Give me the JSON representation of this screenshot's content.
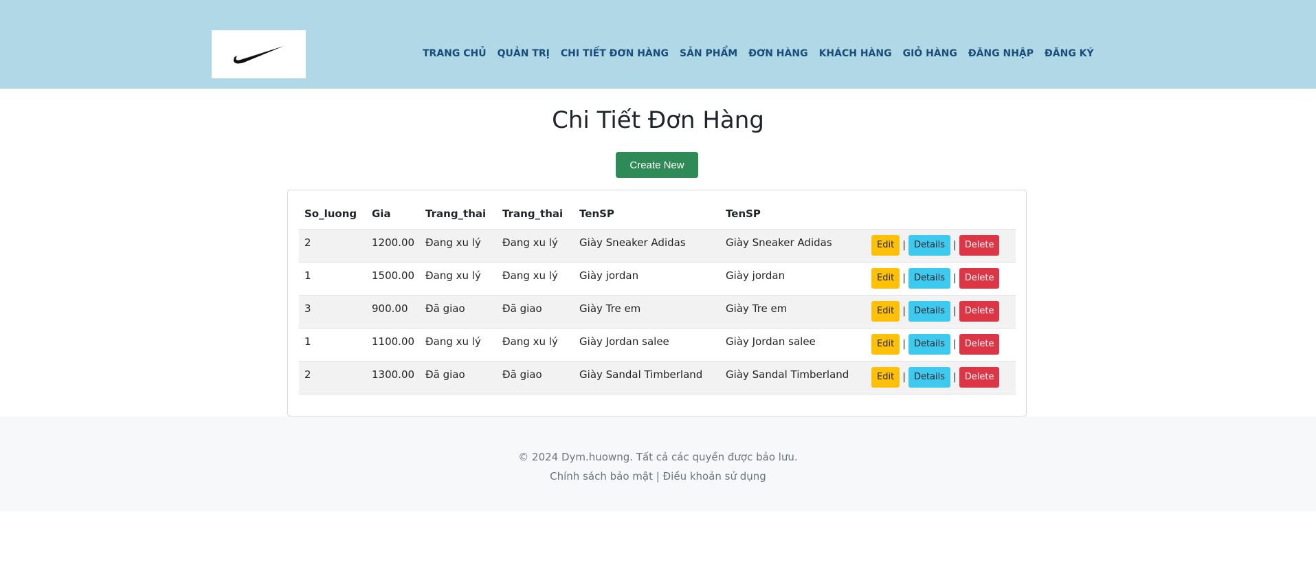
{
  "header": {
    "logo_icon": "nike-swoosh-icon",
    "nav": [
      "TRANG CHỦ",
      "QUẢN TRỊ",
      "CHI TIẾT ĐƠN HÀNG",
      "SẢN PHẨM",
      "ĐƠN HÀNG",
      "KHÁCH HÀNG",
      "GIỎ HÀNG",
      "ĐĂNG NHẬP",
      "ĐĂNG KÝ"
    ]
  },
  "main": {
    "title": "Chi Tiết Đơn Hàng",
    "create_label": "Create New"
  },
  "table": {
    "headers": [
      "So_luong",
      "Gia",
      "Trang_thai",
      "Trang_thai",
      "TenSP",
      "TenSP"
    ],
    "rows": [
      [
        "2",
        "1200.00",
        "Đang xu lý",
        "Đang xu lý",
        "Giày Sneaker Adidas",
        "Giày Sneaker Adidas"
      ],
      [
        "1",
        "1500.00",
        "Đang xu lý",
        "Đang xu lý",
        "Giày jordan",
        "Giày jordan"
      ],
      [
        "3",
        "900.00",
        "Đã giao",
        "Đã giao",
        "Giày Tre em",
        "Giày Tre em"
      ],
      [
        "1",
        "1100.00",
        "Đang xu lý",
        "Đang xu lý",
        "Giày Jordan salee",
        "Giày Jordan salee"
      ],
      [
        "2",
        "1300.00",
        "Đã giao",
        "Đã giao",
        "Giày Sandal Timberland",
        "Giày Sandal Timberland"
      ]
    ],
    "actions": {
      "edit": "Edit",
      "details": "Details",
      "delete": "Delete",
      "separator": "|"
    }
  },
  "footer": {
    "copyright": "© 2024 Dym.huowng. Tất cả các quyền được bảo lưu.",
    "links": "Chính sách bảo mật | Điều khoản sử dụng"
  },
  "colors": {
    "header_bg": "#b0d8e6",
    "nav_text": "#1a4d7a",
    "create_btn": "#2e8b57",
    "edit_btn": "#ffc107",
    "details_btn": "#3ec9ef",
    "delete_btn": "#dc3545"
  }
}
